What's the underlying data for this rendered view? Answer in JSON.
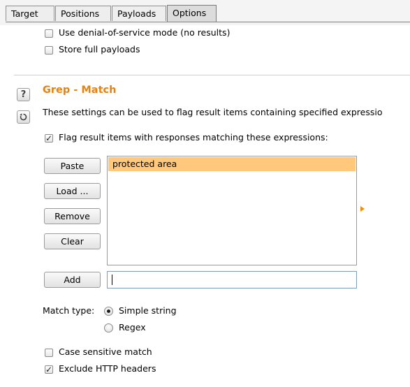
{
  "tabs": [
    {
      "label": "Target",
      "active": false
    },
    {
      "label": "Positions",
      "active": false
    },
    {
      "label": "Payloads",
      "active": false
    },
    {
      "label": "Options",
      "active": true
    }
  ],
  "top_options": {
    "dos_mode": {
      "label": "Use denial-of-service mode (no results)",
      "checked": false
    },
    "store_payloads": {
      "label": "Store full payloads",
      "checked": false
    }
  },
  "grep_match": {
    "help_icon": "question-mark-icon",
    "reset_icon": "refresh-icon",
    "title": "Grep - Match",
    "description": "These settings can be used to flag result items containing specified expressio",
    "flag_checkbox": {
      "label": "Flag result items with responses matching these expressions:",
      "checked": true
    },
    "buttons": {
      "paste": "Paste",
      "load": "Load ...",
      "remove": "Remove",
      "clear": "Clear",
      "add": "Add"
    },
    "expressions": [
      "protected area"
    ],
    "selected_expression_index": 0,
    "add_input_value": "",
    "match_type": {
      "label": "Match type:",
      "options": [
        "Simple string",
        "Regex"
      ],
      "selected": "Simple string"
    },
    "case_sensitive": {
      "label": "Case sensitive match",
      "checked": false
    },
    "exclude_headers": {
      "label": "Exclude HTTP headers",
      "checked": true
    }
  },
  "colors": {
    "section_title": "#e8820e",
    "selection": "#ffc87a",
    "arrow": "#f09000"
  }
}
